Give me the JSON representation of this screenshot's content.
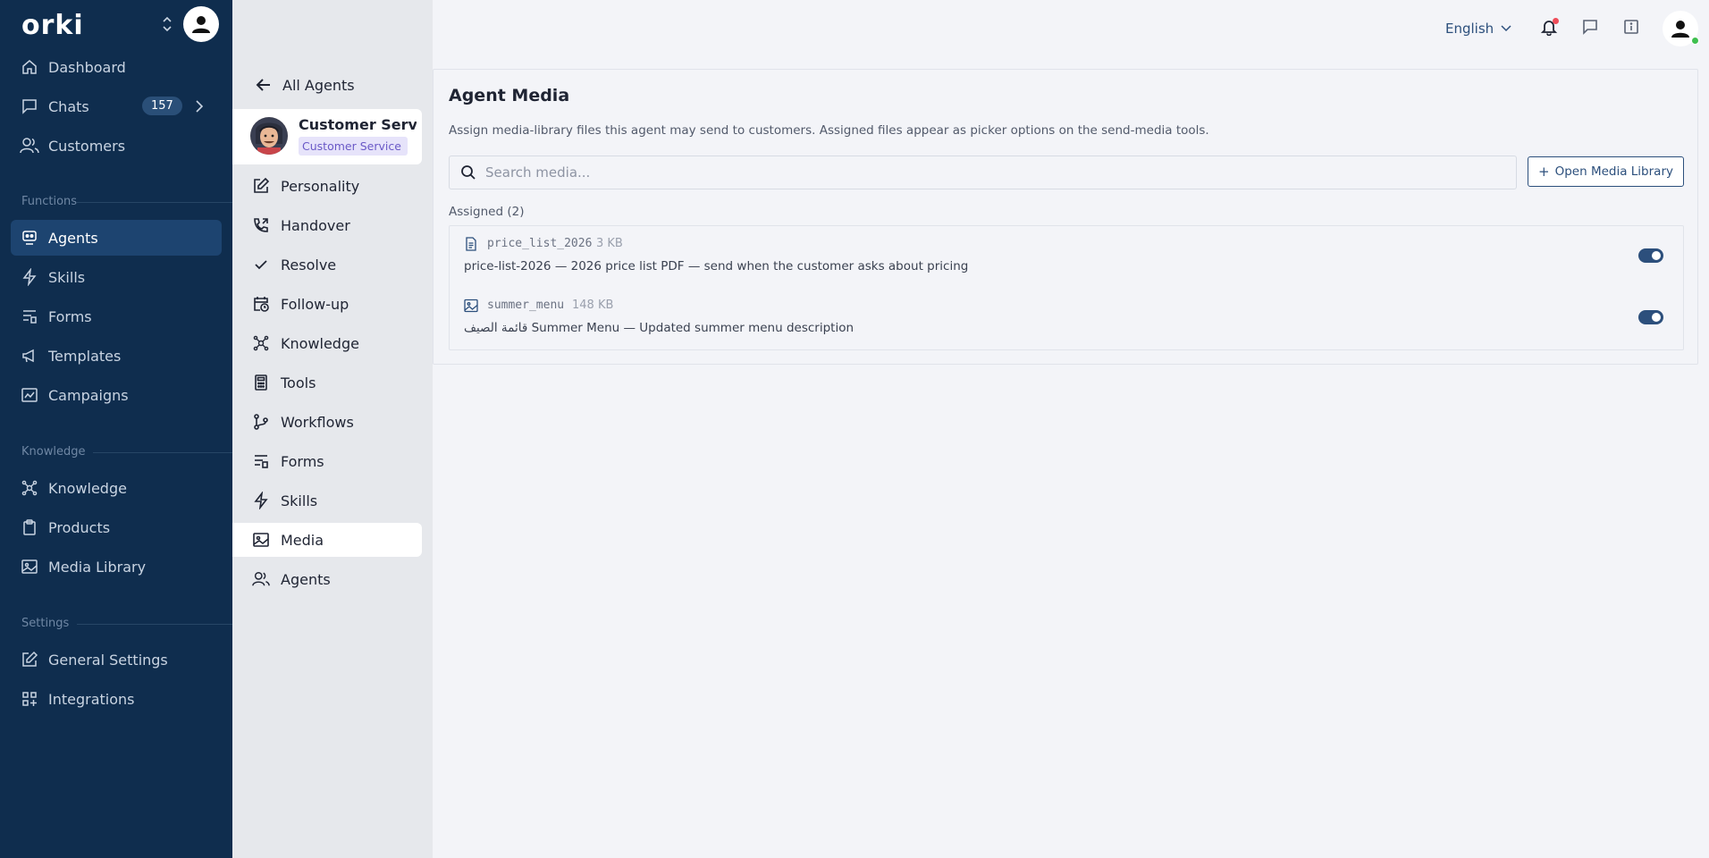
{
  "brand": {
    "name": "orki"
  },
  "sidebar": {
    "items": [
      {
        "label": "Dashboard",
        "icon": "home-icon"
      },
      {
        "label": "Chats",
        "icon": "chat-icon",
        "badge": "157"
      },
      {
        "label": "Customers",
        "icon": "users-icon"
      }
    ],
    "sections": [
      {
        "label": "Functions",
        "items": [
          {
            "label": "Agents",
            "icon": "agent-icon",
            "active": true
          },
          {
            "label": "Skills",
            "icon": "bolt-icon"
          },
          {
            "label": "Forms",
            "icon": "form-icon"
          },
          {
            "label": "Templates",
            "icon": "megaphone-icon"
          },
          {
            "label": "Campaigns",
            "icon": "campaign-icon"
          }
        ]
      },
      {
        "label": "Knowledge",
        "items": [
          {
            "label": "Knowledge",
            "icon": "knowledge-icon"
          },
          {
            "label": "Products",
            "icon": "clipboard-icon"
          },
          {
            "label": "Media Library",
            "icon": "image-icon"
          }
        ]
      },
      {
        "label": "Settings",
        "items": [
          {
            "label": "General Settings",
            "icon": "edit-icon"
          },
          {
            "label": "Integrations",
            "icon": "grid-plus-icon"
          }
        ]
      }
    ]
  },
  "subnav": {
    "back_label": "All Agents",
    "agent": {
      "name": "Customer Service",
      "tag": "Customer Service"
    },
    "items": [
      {
        "label": "Personality",
        "icon": "edit-icon"
      },
      {
        "label": "Handover",
        "icon": "phone-transfer-icon"
      },
      {
        "label": "Resolve",
        "icon": "check-icon"
      },
      {
        "label": "Follow-up",
        "icon": "calendar-clock-icon"
      },
      {
        "label": "Knowledge",
        "icon": "knowledge-icon"
      },
      {
        "label": "Tools",
        "icon": "calculator-icon"
      },
      {
        "label": "Workflows",
        "icon": "workflow-icon"
      },
      {
        "label": "Forms",
        "icon": "form-icon"
      },
      {
        "label": "Skills",
        "icon": "bolt-icon"
      },
      {
        "label": "Media",
        "icon": "image-icon",
        "active": true
      },
      {
        "label": "Agents",
        "icon": "users-icon"
      }
    ]
  },
  "topbar": {
    "language": "English",
    "notification": true
  },
  "main": {
    "title": "Agent Media",
    "description": "Assign media-library files this agent may send to customers. Assigned files appear as picker options on the send-media tools.",
    "search_placeholder": "Search media...",
    "open_library_label": "Open Media Library",
    "assigned_label": "Assigned (2)",
    "media": [
      {
        "name": "price_list_2026",
        "size": "3 KB",
        "description": "price-list-2026 — 2026 price list PDF — send when the customer asks about pricing",
        "icon": "document-icon",
        "enabled": true
      },
      {
        "name": "summer_menu",
        "size": "148 KB",
        "description": "قائمة الصيف Summer Menu — Updated summer menu description",
        "icon": "image-icon",
        "enabled": true
      }
    ]
  },
  "colors": {
    "sidebar": "#0f2d4e",
    "accent": "#2c4f7c",
    "tag_bg": "#e6e3fa",
    "tag_text": "#6a59c7"
  }
}
